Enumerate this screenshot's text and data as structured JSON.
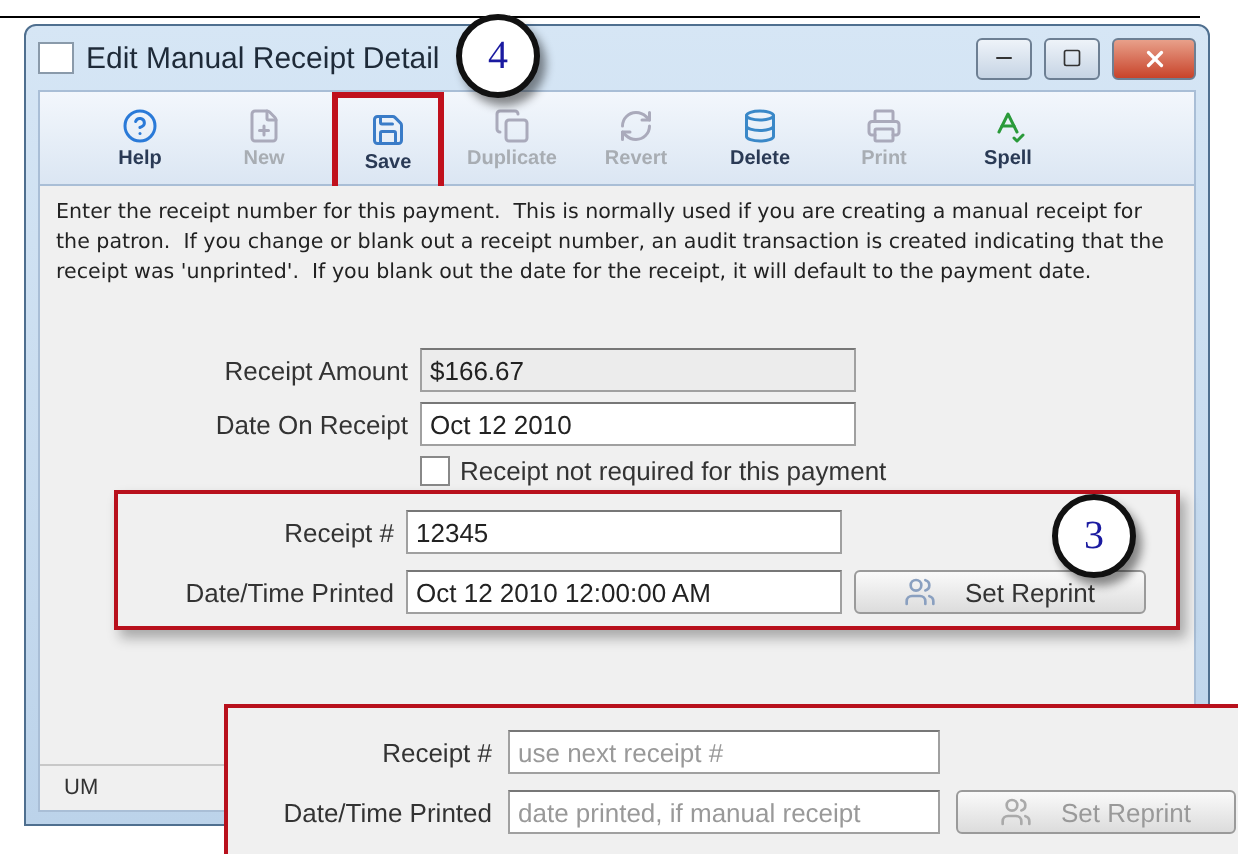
{
  "window": {
    "title": "Edit Manual Receipt Detail"
  },
  "toolbar": [
    {
      "kind": "help",
      "label": "Help",
      "disabled": false,
      "highlighted": false
    },
    {
      "kind": "new",
      "label": "New",
      "disabled": true,
      "highlighted": false
    },
    {
      "kind": "save",
      "label": "Save",
      "disabled": false,
      "highlighted": true
    },
    {
      "kind": "duplicate",
      "label": "Duplicate",
      "disabled": true,
      "highlighted": false
    },
    {
      "kind": "revert",
      "label": "Revert",
      "disabled": true,
      "highlighted": false
    },
    {
      "kind": "delete",
      "label": "Delete",
      "disabled": false,
      "highlighted": false
    },
    {
      "kind": "print",
      "label": "Print",
      "disabled": true,
      "highlighted": false
    },
    {
      "kind": "spell",
      "label": "Spell",
      "disabled": false,
      "highlighted": false
    }
  ],
  "description": "Enter the receipt number for this payment.  This is normally used if you are creating a manual receipt for the patron.  If you change or blank out a receipt number, an audit transaction is created indicating that the receipt was 'unprinted'.  If you blank out the date for the receipt, it will default to the payment date.",
  "fields": [
    {
      "label": "Receipt Amount",
      "value": "$166.67",
      "readonly": true
    },
    {
      "label": "Date On Receipt",
      "value": "Oct 12 2010",
      "readonly": false
    }
  ],
  "checkbox": {
    "label": "Receipt not required for this payment",
    "checked": false
  },
  "highlighted_group": {
    "fields": [
      {
        "label": "Receipt #",
        "value": "12345"
      },
      {
        "label": "Date/Time Printed",
        "value": "Oct 12 2010 12:00:00 AM"
      }
    ],
    "button": {
      "label": "Set Reprint",
      "disabled": false
    }
  },
  "status_bar": [
    "UM"
  ],
  "callouts": [
    "4",
    "3"
  ],
  "inset": {
    "fields": [
      {
        "label": "Receipt #",
        "placeholder": "use next receipt #"
      },
      {
        "label": "Date/Time Printed",
        "placeholder": "date printed, if manual receipt"
      }
    ],
    "button": {
      "label": "Set Reprint",
      "disabled": true
    }
  }
}
